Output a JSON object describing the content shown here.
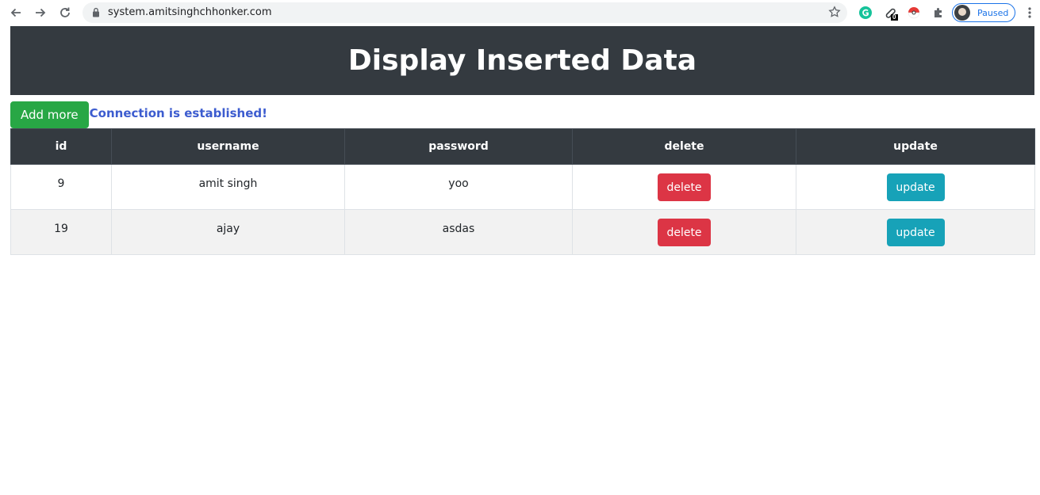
{
  "browser": {
    "url": "system.amitsinghchhonker.com",
    "profile_status": "Paused",
    "extension_badge": "0"
  },
  "page": {
    "title": "Display Inserted Data",
    "add_button_label": "Add more",
    "connection_message": "Connection is established!"
  },
  "table": {
    "headers": [
      "id",
      "username",
      "password",
      "delete",
      "update"
    ],
    "rows": [
      {
        "id": "9",
        "username": "amit singh",
        "password": "yoo",
        "delete_label": "delete",
        "update_label": "update"
      },
      {
        "id": "19",
        "username": "ajay",
        "password": "asdas",
        "delete_label": "delete",
        "update_label": "update"
      }
    ]
  },
  "colors": {
    "header_bg": "#343a40",
    "add_button": "#28a745",
    "delete_button": "#dc3545",
    "update_button": "#17a2b8",
    "connection_text": "#3c5ccf"
  }
}
